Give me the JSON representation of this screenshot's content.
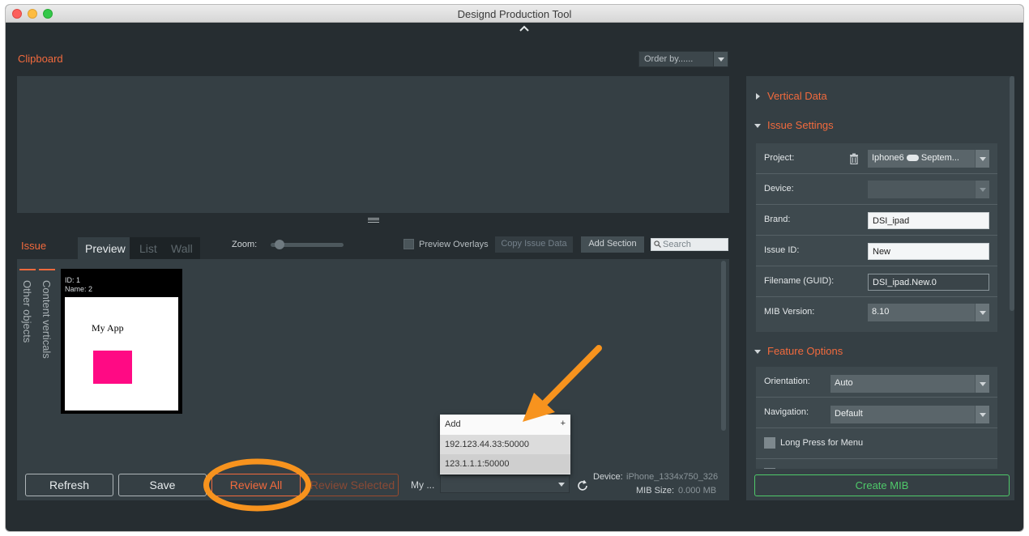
{
  "window": {
    "title": "Designd Production Tool"
  },
  "clipboard": {
    "title": "Clipboard",
    "order_by": "Order by......"
  },
  "issue": {
    "title": "Issue",
    "tabs": [
      "Preview",
      "List",
      "Wall"
    ],
    "zoom_label": "Zoom:",
    "preview_overlays": "Preview Overlays",
    "copy_issue_data": "Copy Issue Data",
    "add_section": "Add Section",
    "search_placeholder": "Search",
    "zoom_level": 0.05
  },
  "side_tabs": [
    "Content verticals",
    "Other objects"
  ],
  "thumbnail": {
    "id": "ID: 1",
    "name": "Name: 2",
    "app_title": "My App"
  },
  "bottom_bar": {
    "refresh": "Refresh",
    "save": "Save",
    "review_all": "Review All",
    "review_selected": "Review Selected",
    "my_label": "My ...",
    "device_label": "Device:",
    "device_value": "iPhone_1334x750_326",
    "mib_label": "MIB Size:",
    "mib_value": "0.000 MB"
  },
  "device_popup": {
    "add_label": "Add",
    "add_plus": "+",
    "items": [
      "192.123.44.33:50000",
      "123.1.1.1:50000"
    ]
  },
  "right_panel": {
    "vertical_data": "Vertical Data",
    "issue_settings": {
      "title": "Issue Settings",
      "project_label": "Project:",
      "project_value": "Iphone6",
      "project_value_suffix": "Septem...",
      "device_label": "Device:",
      "brand_label": "Brand:",
      "brand_value": "DSI_ipad",
      "issue_id_label": "Issue ID:",
      "issue_id_value": "New",
      "filename_label": "Filename (GUID):",
      "filename_value": "DSI_ipad.New.0",
      "mib_version_label": "MIB Version:",
      "mib_version_value": "8.10"
    },
    "feature_options": {
      "title": "Feature Options",
      "orientation_label": "Orientation:",
      "orientation_value": "Auto",
      "navigation_label": "Navigation:",
      "navigation_value": "Default",
      "long_press_label": "Long Press for Menu"
    },
    "create_mib": "Create MIB"
  },
  "colors": {
    "accent": "#f26a3d",
    "create": "#4fc96a",
    "annotation": "#f7931e",
    "thumb_box": "#ff0a84"
  }
}
